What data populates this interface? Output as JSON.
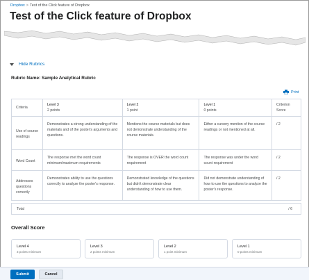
{
  "breadcrumb": {
    "link": "Dropbox",
    "separator": ">",
    "current": "Test of the Click feature of Dropbox"
  },
  "page_title": "Test of the Click feature of Dropbox",
  "hide_rubrics_label": "Hide Rubrics",
  "rubric_name": "Rubric Name: Sample Analytical Rubric",
  "print_label": "Print",
  "table": {
    "criteria_header": "Criteria",
    "levels": [
      {
        "name": "Level 3",
        "points": "2 points"
      },
      {
        "name": "Level 2",
        "points": "1 point"
      },
      {
        "name": "Level 1",
        "points": "0 points"
      }
    ],
    "score_header": "Criterion Score",
    "rows": [
      {
        "criterion": "Use of course readings",
        "cells": [
          "Demonstrates a strong understanding of the materials and of the poster's arguments and questions.",
          "Mentions the course materials but does not demonstrate understanding of the course materials.",
          "Either a cursory mention of the course readings or not mentioned at all."
        ],
        "score": "/ 2"
      },
      {
        "criterion": "Word Count",
        "cells": [
          "The response met the word count minimum/maximum  requirements",
          "The response is OVER the word count requirement",
          "The response was under the word count requirement"
        ],
        "score": "/ 2"
      },
      {
        "criterion": "Addresses questions correctly",
        "cells": [
          "Demonstrates ability to use the questions correctly to analyze the poster's response.",
          "Demonstrated knowledge of the questions but didn't demonstrate clear understanding of how to use them.",
          "Did not demonstrate understanding of how to use the questions to analyze the poster's response."
        ],
        "score": "/ 2"
      }
    ]
  },
  "total": {
    "label": "Total",
    "value": "/ 6"
  },
  "overall_score_label": "Overall Score",
  "score_cards": [
    {
      "name": "Level 4",
      "points": "3 points minimum"
    },
    {
      "name": "Level 3",
      "points": "2 points minimum"
    },
    {
      "name": "Level 2",
      "points": "1 point minimum"
    },
    {
      "name": "Level 1",
      "points": "0 points minimum"
    }
  ],
  "buttons": {
    "submit": "Submit",
    "cancel": "Cancel"
  },
  "colors": {
    "link": "#006fbf",
    "border": "#d3d9e3",
    "primary_button": "#006fbf",
    "footer_bg": "#f1f5fb"
  },
  "icons": {
    "expand_toggle": "triangle-down-icon",
    "print": "printer-icon"
  }
}
